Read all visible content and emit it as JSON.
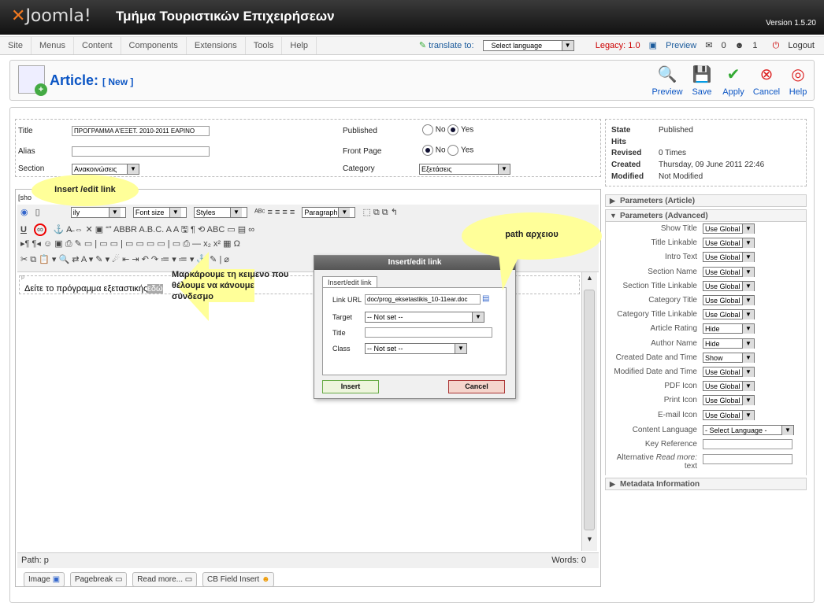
{
  "header": {
    "logo": "Joomla!",
    "site_name": "Τμήμα Τουριστικών Επιχειρήσεων",
    "version": "Version 1.5.20"
  },
  "menu": {
    "items": [
      "Site",
      "Menus",
      "Content",
      "Components",
      "Extensions",
      "Tools",
      "Help"
    ],
    "translate_to": "translate to:",
    "select_language": "Select language",
    "legacy": "Legacy: 1.0",
    "preview": "Preview",
    "count0": "0",
    "count1": "1",
    "logout": "Logout"
  },
  "toolbar": {
    "title": "Article:",
    "subtitle": "[ New ]",
    "buttons": [
      "Preview",
      "Save",
      "Apply",
      "Cancel",
      "Help"
    ]
  },
  "fields": {
    "title_label": "Title",
    "title_value": "ΠΡΟΓΡΑΜΜΑ Α'ΕΞΕΤ. 2010-2011 ΕΑΡΙΝΟ",
    "alias_label": "Alias",
    "alias_value": "",
    "section_label": "Section",
    "section_value": "Ανακοινώσεις",
    "published_label": "Published",
    "no": "No",
    "yes": "Yes",
    "frontpage_label": "Front Page",
    "category_label": "Category",
    "category_value": "Εξετάσεις"
  },
  "info": {
    "state_label": "State",
    "state_value": "Published",
    "hits_label": "Hits",
    "hits_value": "",
    "revised_label": "Revised",
    "revised_value": "0 Times",
    "created_label": "Created",
    "created_value": "Thursday, 09 June 2011 22:46",
    "modified_label": "Modified",
    "modified_value": "Not Modified"
  },
  "editor": {
    "show_toggle": "[sho",
    "font_family": "ily",
    "font_size": "Font size",
    "styles": "Styles",
    "format": "Paragraph",
    "paragraph_marker": "p",
    "content_text": "Δείτε το πρόγραμμα εξεταστικής",
    "selected_text": "εδώ",
    "path": "Path: p",
    "words": "Words: 0",
    "bottom_buttons": [
      "Image",
      "Pagebreak",
      "Read more...",
      "CB Field Insert"
    ]
  },
  "dialog": {
    "title": "Insert/edit link",
    "tab": "Insert/edit link",
    "link_url_label": "Link URL",
    "link_url_value": "doc/prog_eksetastikis_10-11ear.doc",
    "target_label": "Target",
    "target_value": "-- Not set --",
    "title_label": "Title",
    "title_value": "",
    "class_label": "Class",
    "class_value": "-- Not set --",
    "insert": "Insert",
    "cancel": "Cancel"
  },
  "annotations": {
    "insert_link": "Insert /edit link",
    "mark_text": "Μαρκάρουμε τη κειμενο που θέλουμε να κάνουμε σύνδεσμο",
    "path_file": "path αρχειου"
  },
  "panels": {
    "article": "Parameters (Article)",
    "advanced": "Parameters (Advanced)",
    "metadata": "Metadata Information"
  },
  "params": [
    {
      "label": "Show Title",
      "value": "Use Global"
    },
    {
      "label": "Title Linkable",
      "value": "Use Global"
    },
    {
      "label": "Intro Text",
      "value": "Use Global"
    },
    {
      "label": "Section Name",
      "value": "Use Global"
    },
    {
      "label": "Section Title Linkable",
      "value": "Use Global"
    },
    {
      "label": "Category Title",
      "value": "Use Global"
    },
    {
      "label": "Category Title Linkable",
      "value": "Use Global"
    },
    {
      "label": "Article Rating",
      "value": "Hide"
    },
    {
      "label": "Author Name",
      "value": "Hide"
    },
    {
      "label": "Created Date and Time",
      "value": "Show"
    },
    {
      "label": "Modified Date and Time",
      "value": "Use Global"
    },
    {
      "label": "PDF Icon",
      "value": "Use Global"
    },
    {
      "label": "Print Icon",
      "value": "Use Global"
    },
    {
      "label": "E-mail Icon",
      "value": "Use Global"
    }
  ],
  "extra_params": {
    "content_language_label": "Content Language",
    "content_language_value": "- Select Language -",
    "key_reference_label": "Key Reference",
    "alt_read_more_label_1": "Alternative",
    "alt_read_more_label_2": "Read more:",
    "alt_read_more_label_3": "text"
  }
}
